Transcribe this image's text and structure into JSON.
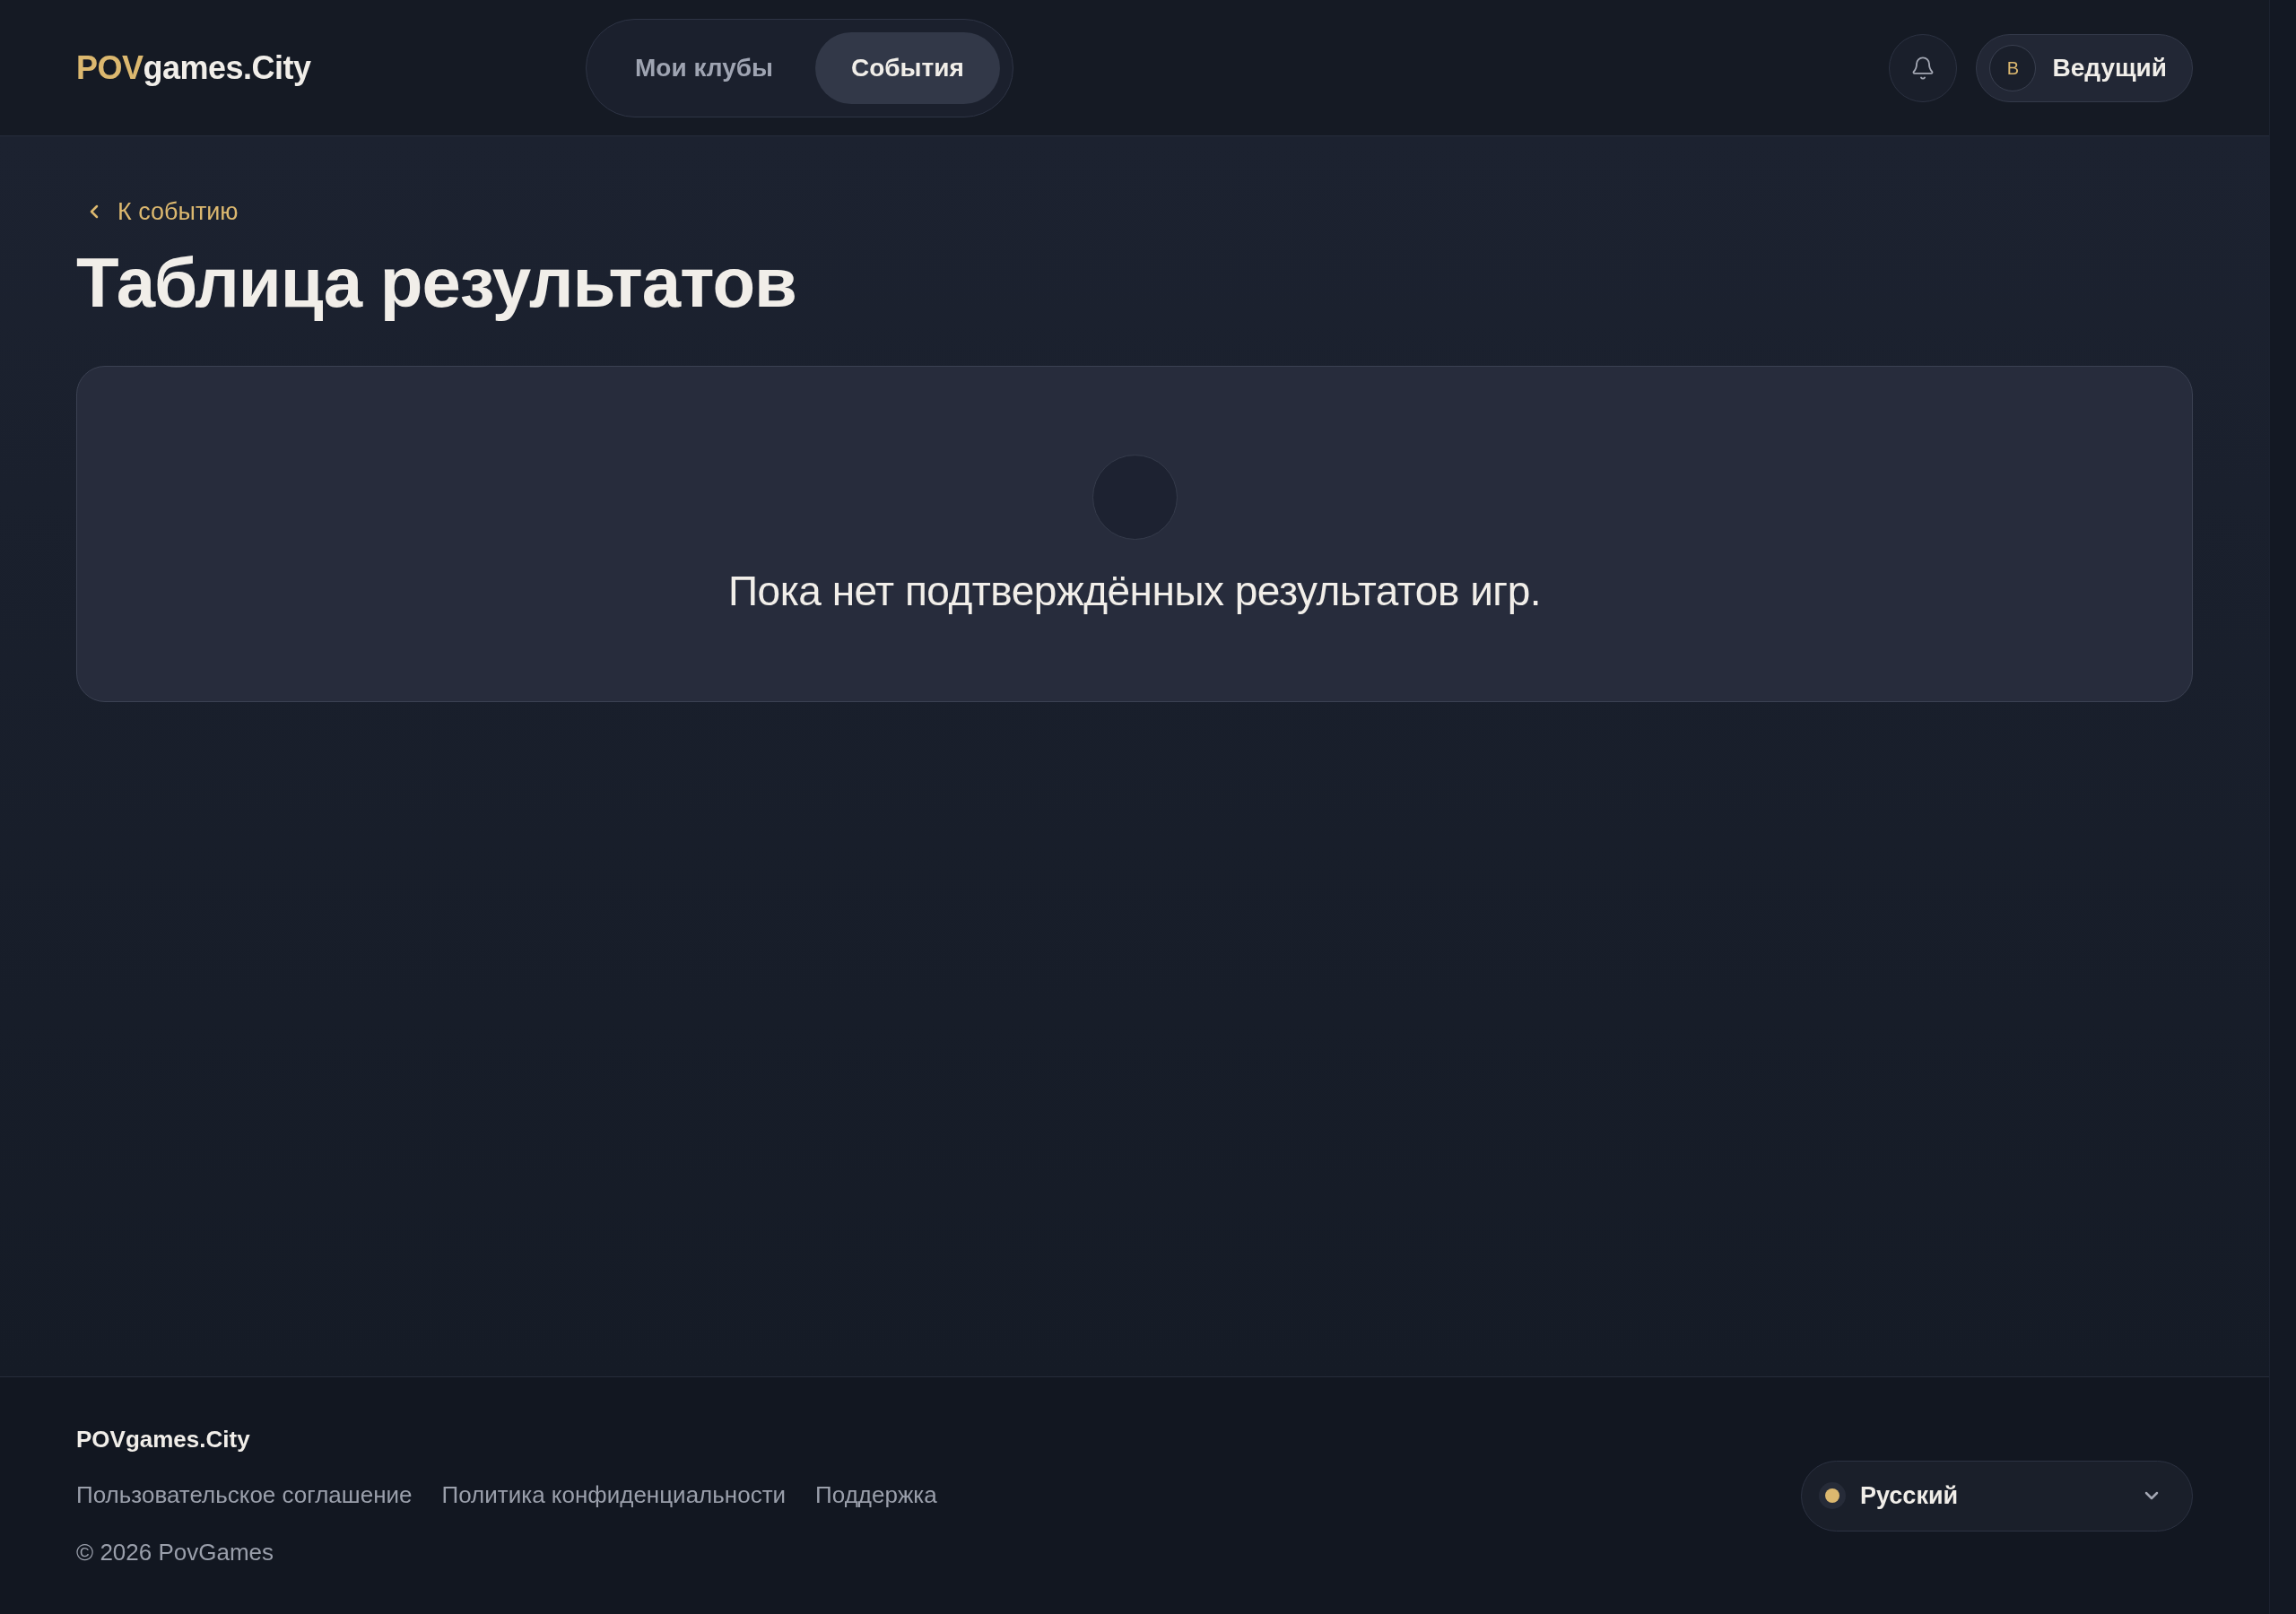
{
  "header": {
    "logo": {
      "accent": "POV",
      "rest": "games.City"
    },
    "tabs": [
      {
        "label": "Мои клубы",
        "selected": false
      },
      {
        "label": "События",
        "selected": true
      }
    ],
    "user": {
      "avatar_initial": "В",
      "name": "Ведущий"
    }
  },
  "back_link": "К событию",
  "title": "Таблица результатов",
  "empty_state": {
    "message": "Пока нет подтверждённых результатов игр."
  },
  "footer": {
    "brand": "POVgames.City",
    "links": [
      "Пользовательское соглашение",
      "Политика конфиденциальности",
      "Поддержка"
    ],
    "copyright": "© 2026 PovGames",
    "language": {
      "label": "Русский"
    }
  }
}
